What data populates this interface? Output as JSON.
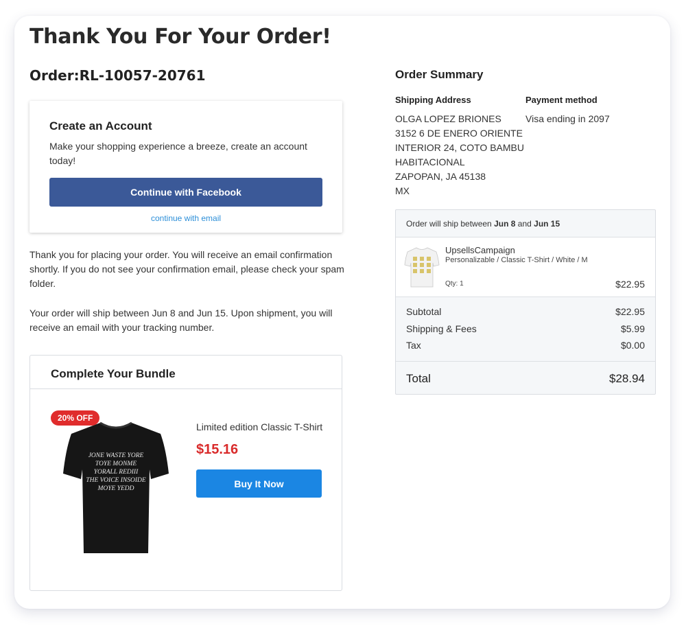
{
  "page": {
    "title": "Thank You For Your Order!",
    "order_label": "Order:RL-10057-20761"
  },
  "account": {
    "title": "Create an Account",
    "description": "Make your shopping experience a breeze, create an account today!",
    "facebook_button": "Continue with Facebook",
    "email_link": "continue with email"
  },
  "messages": {
    "confirmation": "Thank you for placing your order.  You will receive an email confirmation shortly. If you do not see your confirmation email, please check your spam folder.",
    "shipping": "Your order will ship between Jun 8 and Jun 15. Upon shipment, you will receive an email with your tracking number."
  },
  "bundle": {
    "title": "Complete Your Bundle",
    "badge": "20% OFF",
    "product_name": "Limited edition Classic T-Shirt",
    "price": "$15.16",
    "buy_button": "Buy It Now",
    "shirt_text": [
      "JONE WASTE YORE",
      "TOYE MONME",
      "YORALL REDIII",
      "THE VOICE INSOIDE",
      "MOYE YEDD"
    ]
  },
  "summary": {
    "title": "Order Summary",
    "shipping_label": "Shipping Address",
    "payment_label": "Payment method",
    "address_lines": [
      "OLGA LOPEZ BRIONES",
      "3152 6 DE ENERO ORIENTE",
      "INTERIOR 24, COTO BAMBU",
      "HABITACIONAL",
      "ZAPOPAN, JA 45138",
      "MX"
    ],
    "payment_value": "Visa ending in 2097",
    "ship_prefix": "Order will ship between",
    "ship_start": "Jun 8",
    "ship_and": "and",
    "ship_end": "Jun 15",
    "item": {
      "name": "UpsellsCampaign",
      "variant": "Personalizable / Classic T-Shirt / White / M",
      "qty": "Qty: 1",
      "price": "$22.95"
    },
    "subtotal_label": "Subtotal",
    "subtotal_value": "$22.95",
    "shipping_fees_label": "Shipping & Fees",
    "shipping_fees_value": "$5.99",
    "tax_label": "Tax",
    "tax_value": "$0.00",
    "total_label": "Total",
    "total_value": "$28.94"
  },
  "colors": {
    "facebook": "#3b5998",
    "buy_button": "#1b86e3",
    "sale_red": "#d92b2b",
    "link": "#2d8fd8"
  }
}
